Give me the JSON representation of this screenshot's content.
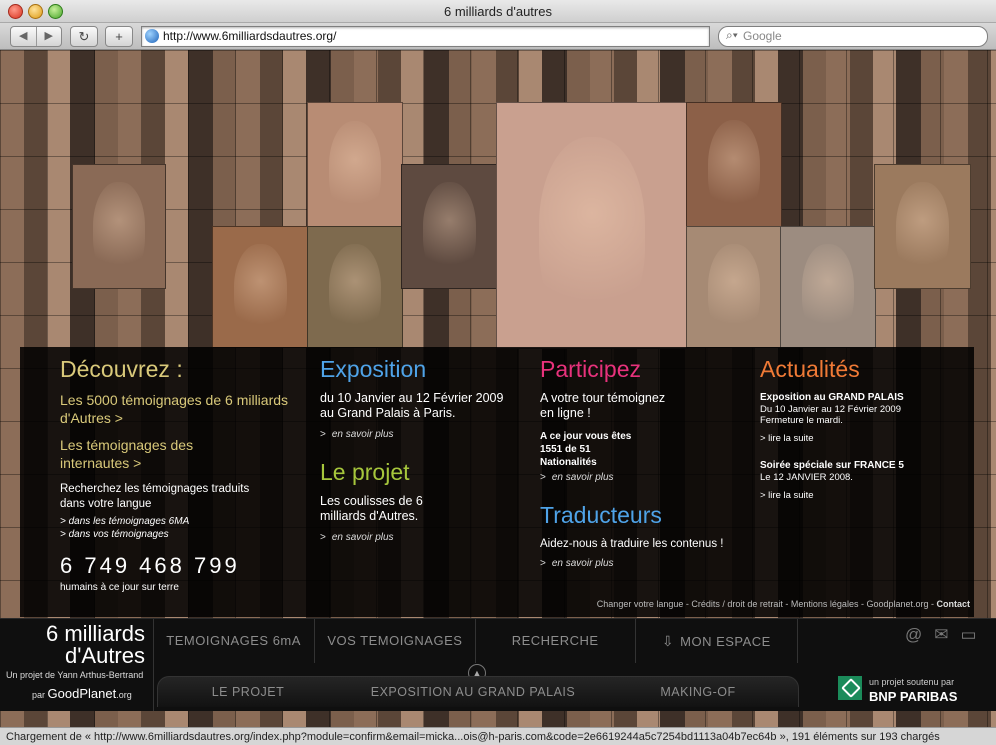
{
  "window": {
    "title": "6 milliards d'autres"
  },
  "toolbar": {
    "back": "◀",
    "forward": "▶",
    "reload": "↻",
    "add": "+",
    "url": "http://www.6milliardsdautres.org/",
    "search_placeholder": "Google"
  },
  "discover": {
    "heading": "Découvrez :",
    "link1": "Les 5000 témoignages de 6 milliards d'Autres >",
    "link2": "Les témoignages des internautes  >",
    "search_text": "Recherchez les témoignages traduits dans votre langue",
    "search_link1": "> dans les témoignages 6MA",
    "search_link2": "> dans vos témoignages",
    "counter": "6 749 468 799",
    "counter_caption": "humains à ce jour sur terre"
  },
  "exposition": {
    "heading": "Exposition",
    "text": "du 10 Janvier au 12 Février 2009 au Grand Palais à Paris.",
    "more": "en savoir plus"
  },
  "projet": {
    "heading": "Le projet",
    "text": "Les coulisses de 6 milliards d'Autres.",
    "more": "en savoir plus"
  },
  "participez": {
    "heading": "Participez",
    "text": "A votre tour témoignez en ligne !",
    "stat": "A ce jour vous êtes 1551 de 51 Nationalités",
    "more": "en savoir plus"
  },
  "traducteurs": {
    "heading": "Traducteurs",
    "text": "Aidez-nous à traduire les contenus !",
    "more": "en savoir plus"
  },
  "actualites": {
    "heading": "Actualités",
    "item1_title": "Exposition au GRAND PALAIS",
    "item1_text": "Du 10 Janvier au 12 Février 2009 Fermeture le mardi.",
    "item1_more": "> lire la suite",
    "item2_title": "Soirée spéciale sur FRANCE 5",
    "item2_text": "Le 12 JANVIER 2008.",
    "item2_more": "> lire la suite"
  },
  "footer_links": {
    "l1": "Changer votre langue",
    "l2": "Crédits / droit de retrait",
    "l3": "Mentions légales",
    "l4": "Goodplanet.org",
    "l5": "Contact",
    "sep": " - "
  },
  "logo": {
    "title1": "6 milliards",
    "title2": "d'Autres",
    "subtitle": "Un projet de Yann Arthus-Bertrand",
    "par": "par",
    "goodplanet": "GoodPlanet",
    "goodplanet_suffix": ".org"
  },
  "menu": {
    "top": [
      "TEMOIGNAGES 6mA",
      "VOS TEMOIGNAGES",
      "RECHERCHE",
      "MON ESPACE"
    ],
    "bottom": [
      "LE PROJET",
      "EXPOSITION AU GRAND PALAIS",
      "MAKING-OF"
    ]
  },
  "sponsor": {
    "label": "un projet soutenu par",
    "name": "BNP PARIBAS"
  },
  "colors": {
    "yellow": "#d9c97a",
    "blue": "#4fa3e8",
    "pink": "#e8327c",
    "orange": "#f07a36",
    "green": "#a6c63c"
  },
  "status": "Chargement de « http://www.6milliardsdautres.org/index.php?module=confirm&email=micka...ois@h-paris.com&code=2e6619244a5c7254bd1113a04b7ec64b », 191 éléments sur 193 chargés"
}
